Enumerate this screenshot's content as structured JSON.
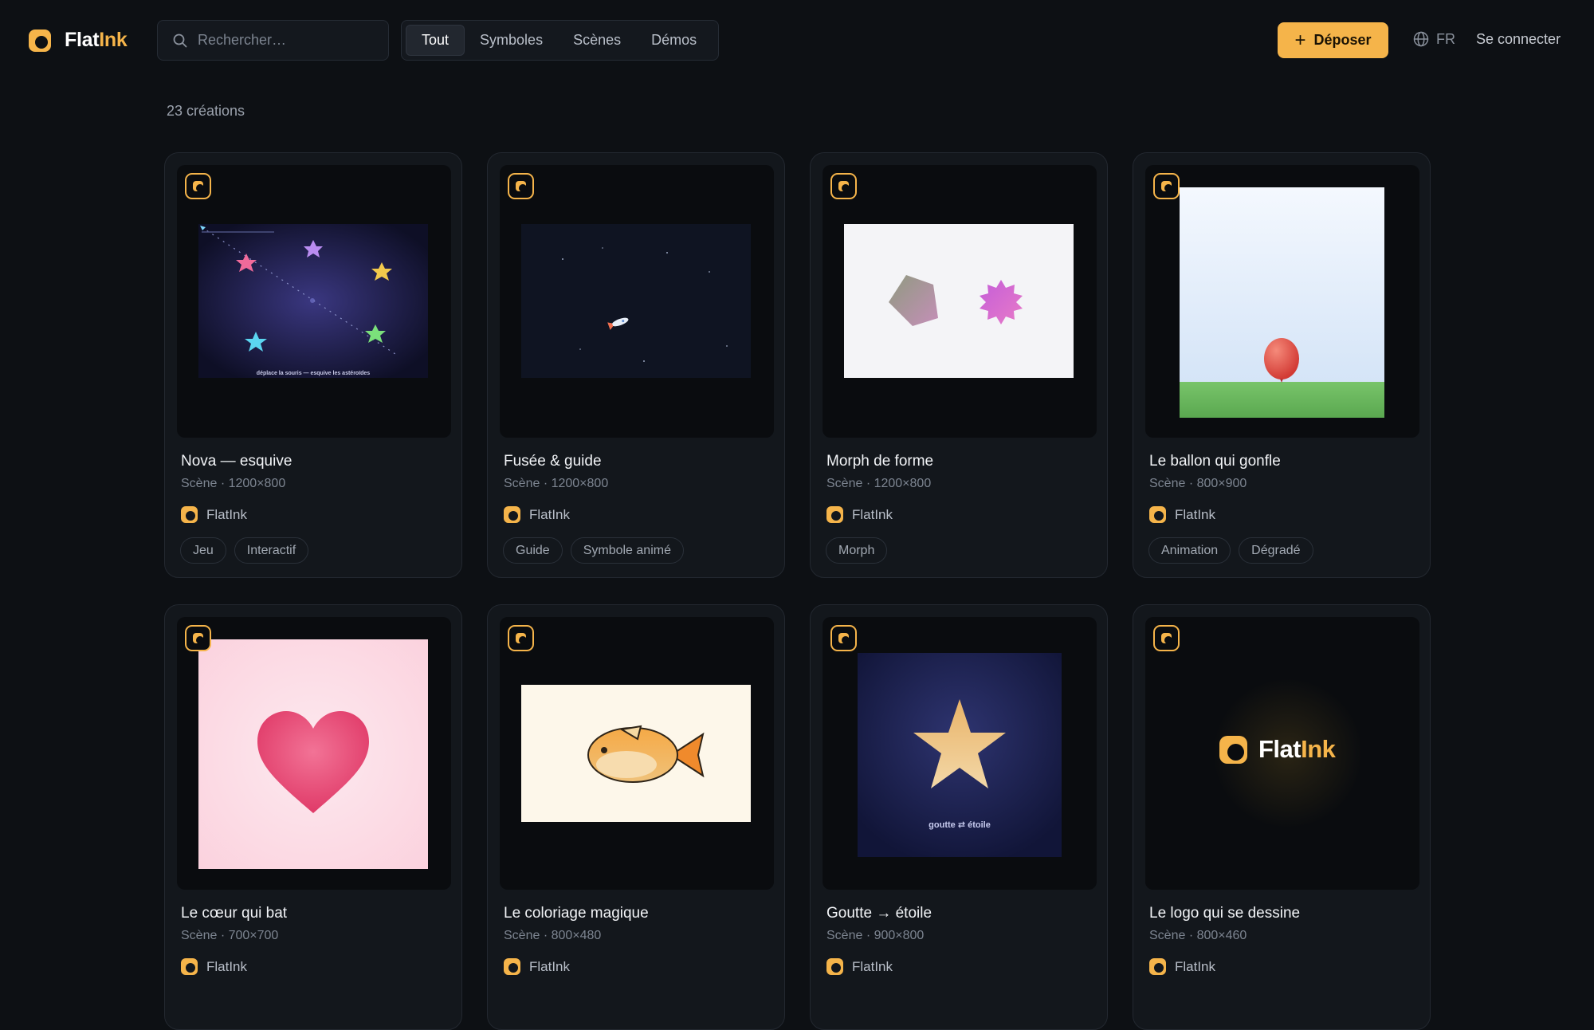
{
  "app": {
    "brand_part1": "Flat",
    "brand_part2": "Ink",
    "accent_color": "#f5b44a",
    "background_color": "#0d1014"
  },
  "search": {
    "placeholder": "Rechercher…",
    "icon": "search-icon"
  },
  "filters": [
    "Tout",
    "Symboles",
    "Scènes",
    "Démos"
  ],
  "active_filter": "Tout",
  "header": {
    "upload_label": "Déposer",
    "upload_icon": "plus-icon",
    "lang_icon": "globe-icon",
    "lang_label": "FR",
    "login_label": "Se connecter"
  },
  "results": {
    "count_label": "23 créations"
  },
  "cards": [
    {
      "title": "Nova — esquive",
      "meta": "Scène · 1200×800",
      "author": "FlatInk",
      "tags": [
        "Jeu",
        "Interactif"
      ],
      "preview_caption": "déplace la souris — esquive les astéroïdes"
    },
    {
      "title": "Fusée & guide",
      "meta": "Scène · 1200×800",
      "author": "FlatInk",
      "tags": [
        "Guide",
        "Symbole animé"
      ]
    },
    {
      "title": "Morph de forme",
      "meta": "Scène · 1200×800",
      "author": "FlatInk",
      "tags": [
        "Morph"
      ]
    },
    {
      "title": "Le ballon qui gonfle",
      "meta": "Scène · 800×900",
      "author": "FlatInk",
      "tags": [
        "Animation",
        "Dégradé"
      ]
    },
    {
      "title": "Le cœur qui bat",
      "meta": "Scène · 700×700",
      "author": "FlatInk",
      "tags": []
    },
    {
      "title": "Le coloriage magique",
      "meta": "Scène · 800×480",
      "author": "FlatInk",
      "tags": []
    },
    {
      "title": "Goutte → étoile",
      "meta": "Scène · 900×800",
      "author": "FlatInk",
      "tags": [],
      "preview_caption": "goutte ⇄ étoile"
    },
    {
      "title": "Le logo qui se dessine",
      "meta": "Scène · 800×460",
      "author": "FlatInk",
      "tags": [],
      "preview_logo_part1": "Flat",
      "preview_logo_part2": "Ink"
    }
  ]
}
